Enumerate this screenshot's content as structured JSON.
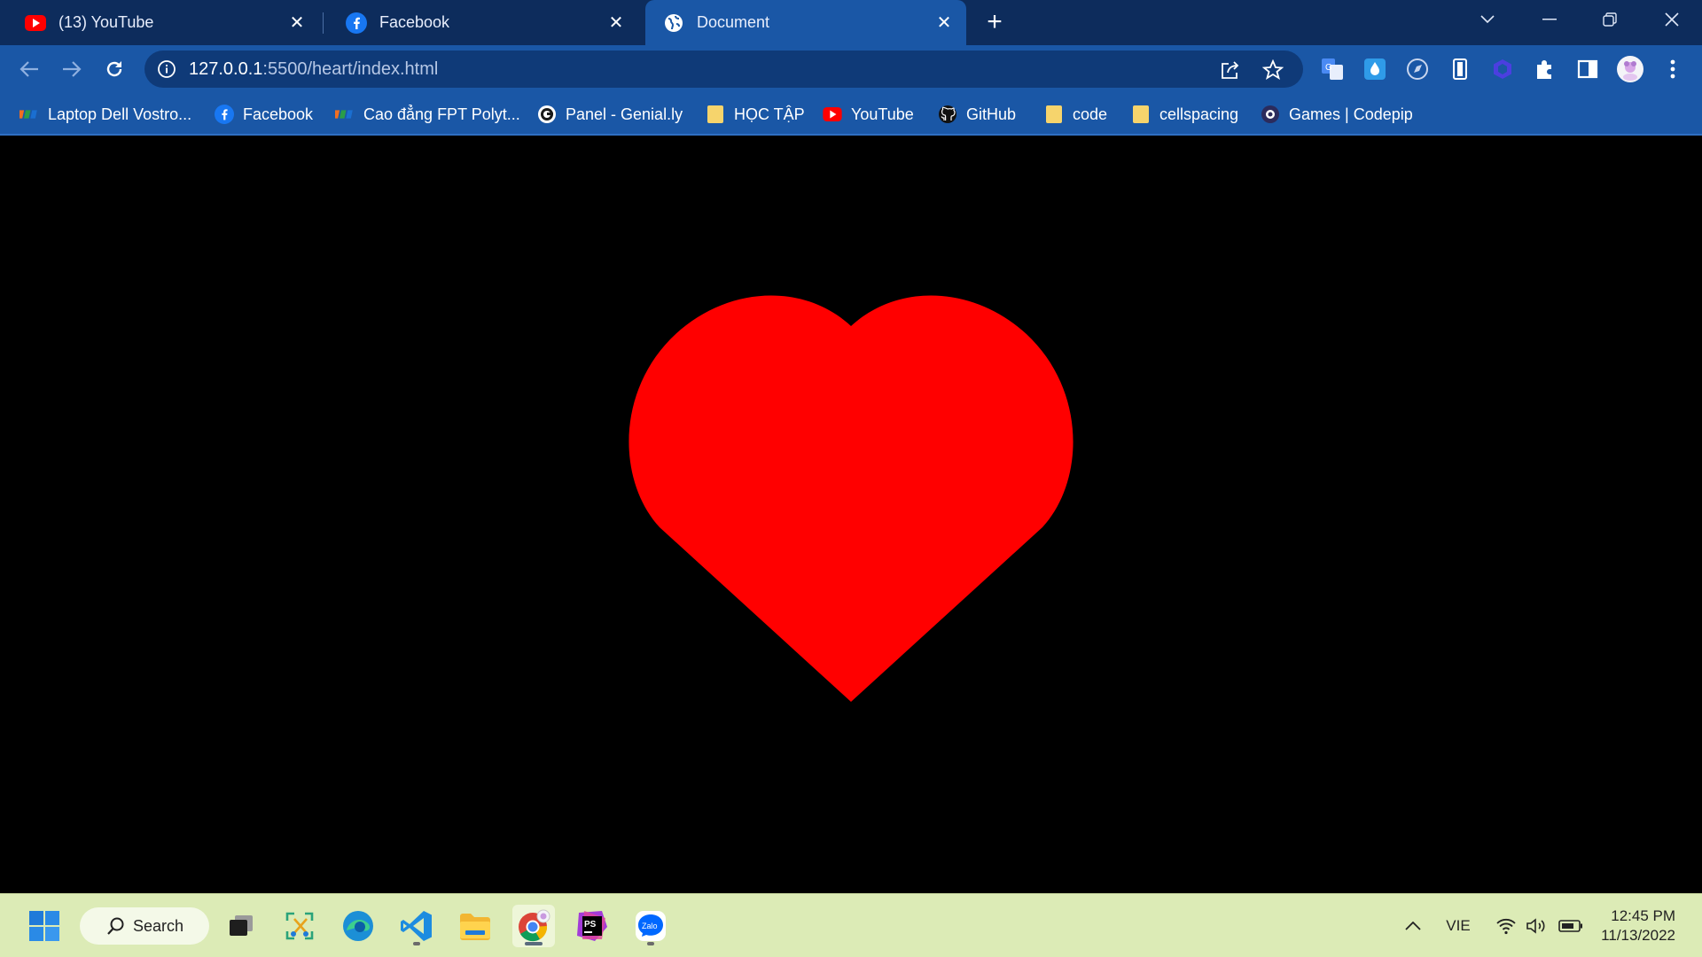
{
  "tabs": [
    {
      "title": "(13) YouTube",
      "icon": "youtube-icon"
    },
    {
      "title": "Facebook",
      "icon": "facebook-icon"
    },
    {
      "title": "Document",
      "icon": "globe-icon",
      "active": true
    }
  ],
  "address_bar": {
    "host": "127.0.0.1",
    "path": ":5500/heart/index.html"
  },
  "bookmarks": [
    {
      "label": "Laptop Dell Vostro...",
      "icon": "fpt-icon"
    },
    {
      "label": "Facebook",
      "icon": "facebook-icon"
    },
    {
      "label": "Cao đẳng FPT Polyt...",
      "icon": "fpt-icon"
    },
    {
      "label": "Panel - Genial.ly",
      "icon": "genially-icon"
    },
    {
      "label": "HỌC TẬP",
      "icon": "folder-icon"
    },
    {
      "label": "YouTube",
      "icon": "youtube-icon"
    },
    {
      "label": "GitHub",
      "icon": "github-icon"
    },
    {
      "label": "code",
      "icon": "folder-icon"
    },
    {
      "label": "cellspacing",
      "icon": "folder-icon"
    },
    {
      "label": "Games | Codepip",
      "icon": "codepip-icon"
    }
  ],
  "page": {
    "background": "#000000",
    "heart_color": "#ff0000"
  },
  "taskbar": {
    "search_label": "Search",
    "language": "VIE",
    "time": "12:45 PM",
    "date": "11/13/2022"
  },
  "colors": {
    "tabstrip": "#0d2c5c",
    "toolbar": "#1a57a6",
    "taskbar": "#dcebb6"
  }
}
